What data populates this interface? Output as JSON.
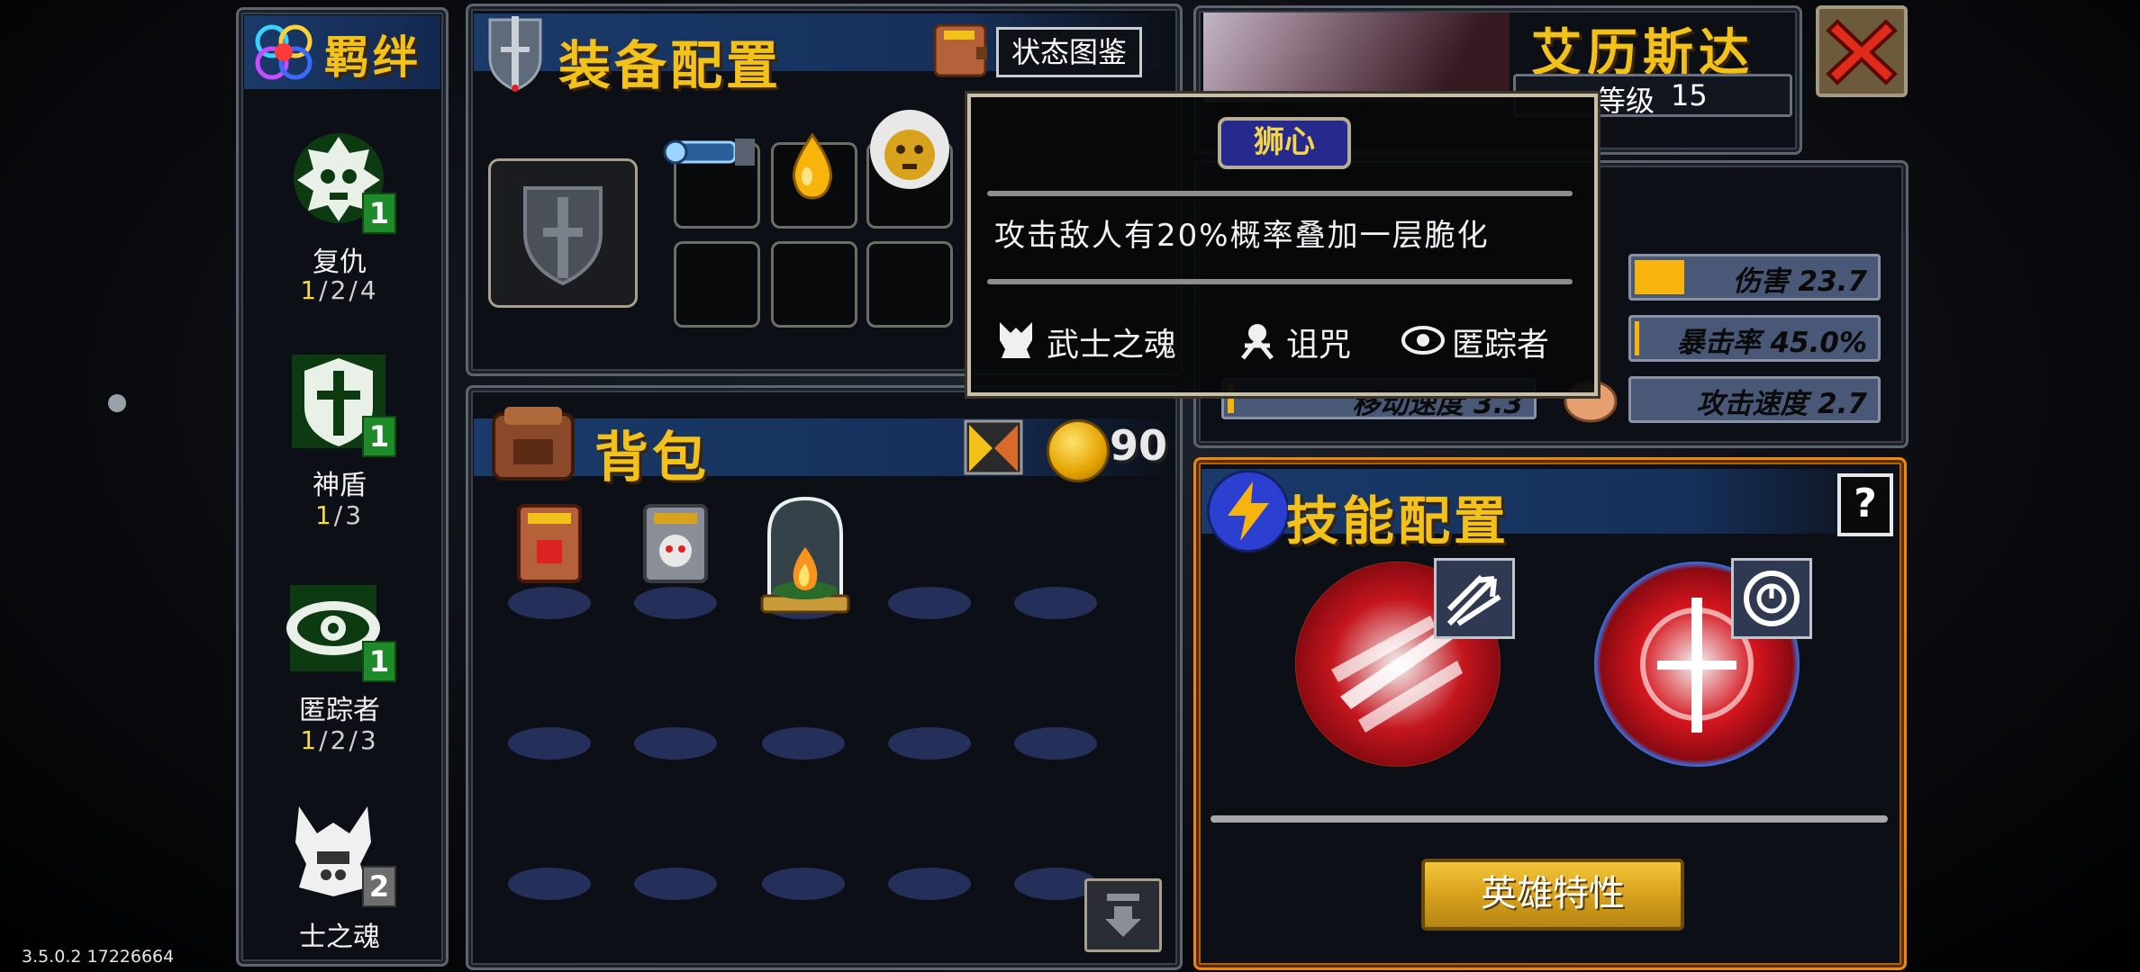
{
  "version": "3.5.0.2 17226664",
  "synergy": {
    "title": "羁绊",
    "items": [
      {
        "name": "复仇",
        "badge": "1",
        "count_hl": "1",
        "count_rest": "/2/4"
      },
      {
        "name": "神盾",
        "badge": "1",
        "count_hl": "1",
        "count_rest": "/3"
      },
      {
        "name": "匿踪者",
        "badge": "1",
        "count_hl": "1",
        "count_rest": "/2/3"
      },
      {
        "name": "士之魂",
        "badge": "2",
        "count_hl": "",
        "count_rest": ""
      }
    ]
  },
  "equipment": {
    "title": "装备配置",
    "status_button": "状态图鉴"
  },
  "hero": {
    "name": "艾历斯达",
    "level_label": "等级",
    "level_value": "15"
  },
  "stats": [
    {
      "label": "伤害",
      "value": "23.7",
      "fill": 0.2
    },
    {
      "label": "暴击率",
      "value": "45.0%",
      "fill": 0.02
    },
    {
      "label": "移动速度",
      "value": "3.3",
      "fill": 0.02
    },
    {
      "label": "攻击速度",
      "value": "2.7",
      "fill": 0.0
    }
  ],
  "tooltip": {
    "name": "狮心",
    "description": "攻击敌人有20%概率叠加一层脆化",
    "tags": [
      "武士之魂",
      "诅咒",
      "匿踪者"
    ]
  },
  "bag": {
    "title": "背包",
    "gold": "90"
  },
  "skills": {
    "title": "技能配置",
    "help": "?",
    "trait_button": "英雄特性"
  },
  "colors": {
    "gold": "#f2c21a",
    "panel_border": "#5d6470",
    "skill_border": "#e88a12",
    "badge_green": "#1e8a2a"
  }
}
